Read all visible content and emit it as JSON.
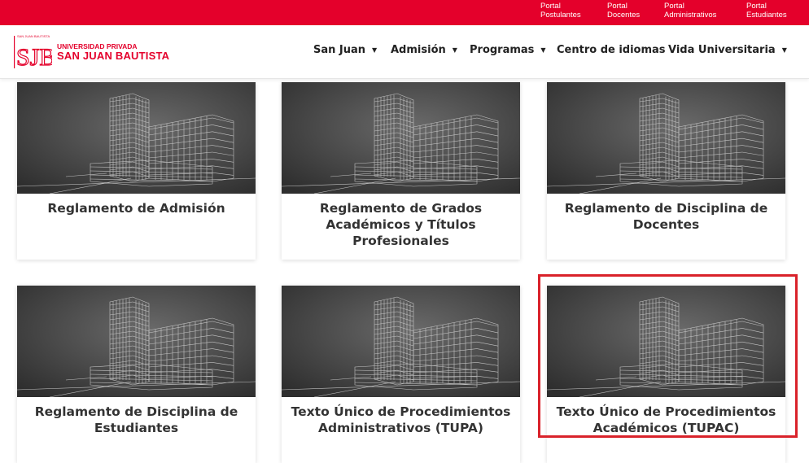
{
  "topbar": {
    "portals": [
      {
        "line1": "Portal",
        "line2": "Postulantes"
      },
      {
        "line1": "Portal",
        "line2": "Docentes"
      },
      {
        "line1": "Portal",
        "line2": "Administrativos"
      },
      {
        "line1": "Portal",
        "line2": "Estudiantes"
      }
    ]
  },
  "logo": {
    "line1": "UNIVERSIDAD PRIVADA",
    "line2": "SAN JUAN BAUTISTA",
    "mark": "SJB",
    "mark_top": "SAN JUAN BAUTISTA"
  },
  "nav": {
    "items": [
      {
        "label": "San Juan",
        "has_dropdown": true
      },
      {
        "label": "Admisión",
        "has_dropdown": true
      },
      {
        "label": "Programas",
        "has_dropdown": true
      },
      {
        "label": "Centro de idiomas",
        "has_dropdown": false
      },
      {
        "label": "Vida Universitaria",
        "has_dropdown": true
      }
    ]
  },
  "cards": [
    {
      "title": "Reglamento de Admisión"
    },
    {
      "title": "Reglamento de Grados Académicos y Títulos Profesionales"
    },
    {
      "title": "Reglamento de Disciplina de Docentes"
    },
    {
      "title": "Reglamento de Disciplina de Estudiantes"
    },
    {
      "title": "Texto Único de Procedimientos Administrativos (TUPA)"
    },
    {
      "title": "Texto Único de Procedimientos Académicos (TUPAC)"
    }
  ],
  "colors": {
    "brand_red": "#e4002b",
    "highlight": "#d9222a"
  }
}
